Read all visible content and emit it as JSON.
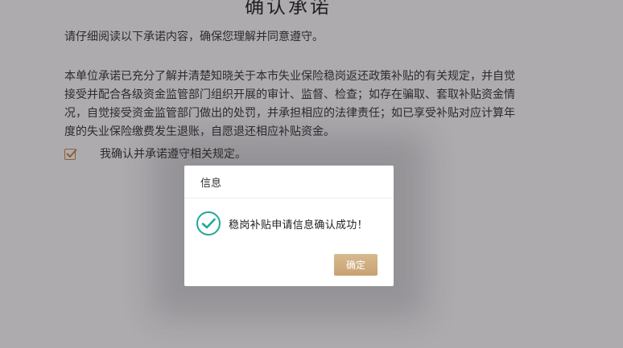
{
  "page": {
    "title": "确认承诺",
    "intro": "请仔细阅读以下承诺内容，确保您理解并同意遵守。",
    "commitment_text": "本单位承诺已充分了解并清楚知晓关于本市失业保险稳岗返还政策补贴的有关规定，并自觉接受并配合各级资金监管部门组织开展的审计、监督、检查；如存在骗取、套取补贴资金情况，自觉接受资金监管部门做出的处罚，并承担相应的法律责任；如已享受补贴对应计算年度的失业保险缴费发生退账，自愿退还相应补贴资金。",
    "confirm_label": "我确认并承诺遵守相关规定。",
    "confirm_checked": true
  },
  "dialog": {
    "title": "信息",
    "message": "稳岗补贴申请信息确认成功！",
    "ok_label": "确定",
    "icon": "check-circle-icon"
  },
  "colors": {
    "accent": "#c7a273",
    "checkbox": "#c87a33",
    "success_icon": "#1fa89a"
  }
}
